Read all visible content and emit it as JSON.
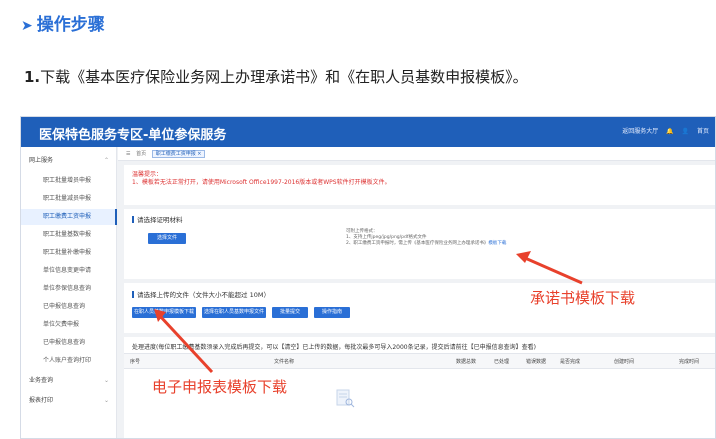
{
  "heading": {
    "arrow": "➤",
    "title": "操作步骤"
  },
  "intro": {
    "num": "1.",
    "text": "下载《基本医疗保险业务网上办理承诺书》和《在职人员基数申报模板》。"
  },
  "app": {
    "title": "医保特色服务专区-单位参保服务",
    "top_right": [
      "返回服务大厅",
      "首页"
    ],
    "sidebar": [
      {
        "label": "网上服务",
        "group": true
      },
      {
        "label": "职工批量增员申报"
      },
      {
        "label": "职工批量减员申报"
      },
      {
        "label": "职工缴费工资申报",
        "active": true
      },
      {
        "label": "职工批量基数申报"
      },
      {
        "label": "职工批量补缴申报"
      },
      {
        "label": "单位信息变更申请"
      },
      {
        "label": "单位参保信息查询"
      },
      {
        "label": "已申报信息查询"
      },
      {
        "label": "单位欠费申报"
      },
      {
        "label": "已申报信息查询"
      },
      {
        "label": "个人账户查询打印"
      },
      {
        "label": "业务查询",
        "group": true
      },
      {
        "label": "报表打印",
        "group": true
      }
    ],
    "breadcrumb": {
      "home": "首页",
      "tab": "职工缴费工资申报 ×"
    },
    "tips": {
      "label": "温馨提示：",
      "text": "1、模板若无法正常打开，请使用Microsoft Office1997-2016版本或者WPS软件打开模板文件。"
    },
    "upload_material": {
      "title": "请选择证明材料",
      "button": "选择文件",
      "notes": [
        "可附上传格式：",
        "1、支持上传jpeg/jpg/png/pdf格式文件",
        "2、职工缴费工资申报时，需上传《基本医疗保险业务网上办理承诺书》"
      ],
      "note_link": "模板下载"
    },
    "upload_file": {
      "title": "请选择上传的文件（文件大小不能超过 10M）",
      "buttons": [
        "在职人员基数申报模板下载",
        "选择在职人员基数申报文件",
        "批量提交",
        "操作指南"
      ]
    },
    "notice": "处理进度(每位职工缴费基数须录入完成后再提交，可以【清空】已上传的数据，每批次最多可导入2000条记录，提交后请前往【已申报信息查询】查看)",
    "table_headers": [
      "序号",
      "文件名称",
      "数据总数",
      "已处理",
      "错误数据",
      "是否完成",
      "创建时间",
      "完成时间"
    ]
  },
  "annotations": {
    "commitment": "承诺书模板下载",
    "declaration": "电子申报表模板下载"
  },
  "colors": {
    "brand": "#1f5fb9",
    "annotation": "#e8412c",
    "heading": "#2a6fd6"
  }
}
